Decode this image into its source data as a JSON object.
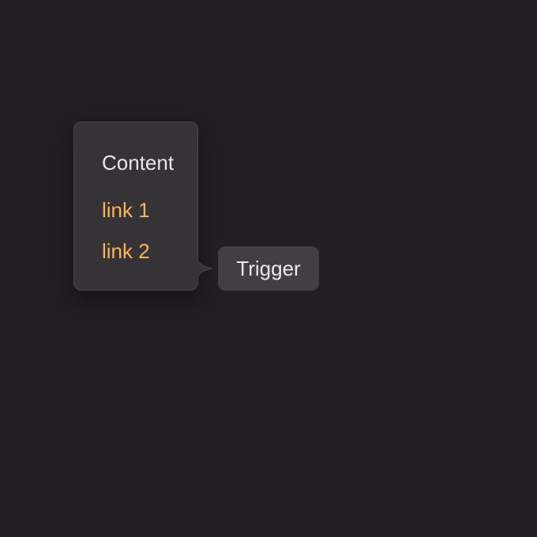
{
  "popover": {
    "title": "Content",
    "links": [
      {
        "label": "link 1"
      },
      {
        "label": "link 2"
      }
    ]
  },
  "trigger": {
    "label": "Trigger"
  },
  "colors": {
    "background": "#221f24",
    "popover_bg": "#363337",
    "link": "#fdb45a",
    "trigger_bg": "#423f44",
    "text": "#e9e6ea"
  }
}
